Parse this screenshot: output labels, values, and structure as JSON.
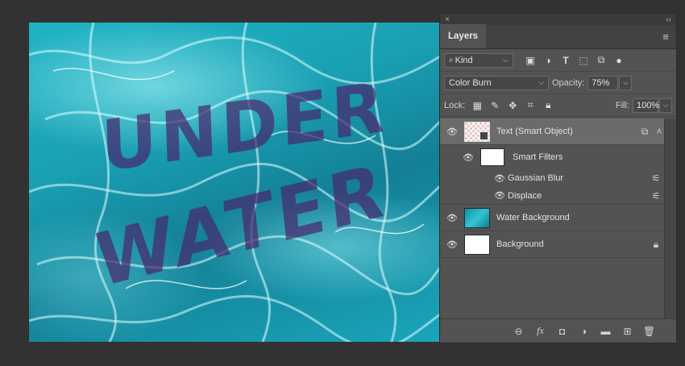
{
  "canvas": {
    "line1": "UNDER",
    "line2": "WATER"
  },
  "panel": {
    "close": "×",
    "collapse": "‹‹",
    "tab": "Layers",
    "menu": "≡",
    "filter": {
      "kind": "Kind",
      "search_icon": "🔍",
      "icons": [
        "image-filter-icon",
        "adjustment-filter-icon",
        "type-filter-icon",
        "shape-filter-icon",
        "smart-object-filter-icon"
      ]
    },
    "blend_mode": "Color Burn",
    "opacity_label": "Opacity:",
    "opacity": "75%",
    "lock_label": "Lock:",
    "fill_label": "Fill:",
    "fill": "100%",
    "layers": [
      {
        "name": "Text (Smart Object)",
        "thumb": "smart"
      },
      {
        "name": "Smart Filters",
        "thumb": "white"
      },
      {
        "name": "Gaussian Blur"
      },
      {
        "name": "Displace"
      },
      {
        "name": "Water Background",
        "thumb": "water"
      },
      {
        "name": "Background",
        "thumb": "white"
      }
    ]
  },
  "colors": {
    "panel_bg": "#535353",
    "selected_row": "#6b6b6b",
    "app_bg": "#323232",
    "water": "#1aa6bb"
  }
}
